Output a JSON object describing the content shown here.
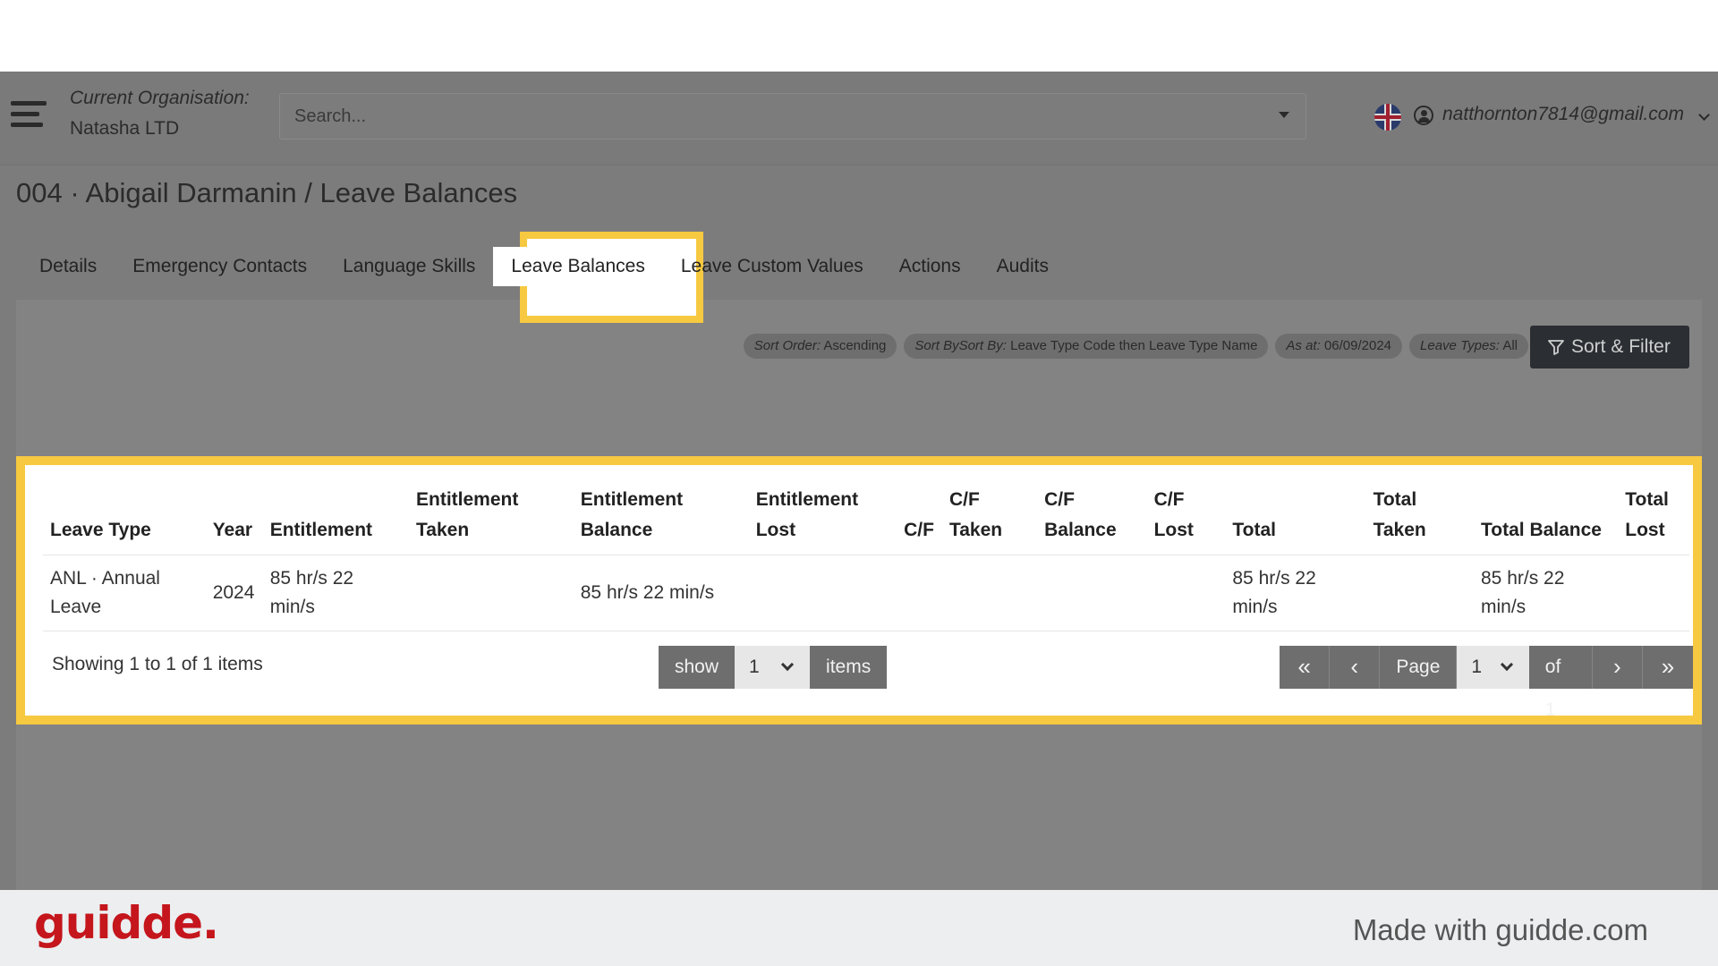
{
  "header": {
    "org_label": "Current Organisation:",
    "org_name": "Natasha LTD",
    "search_placeholder": "Search...",
    "email": "natthornton7814@gmail.com"
  },
  "page": {
    "title_prefix": "004 · Abigail Darmanin / ",
    "title_current": "Leave Balances"
  },
  "tabs": [
    {
      "label": "Details"
    },
    {
      "label": "Emergency Contacts"
    },
    {
      "label": "Language Skills"
    },
    {
      "label": "Leave Balances",
      "active": true
    },
    {
      "label": "Leave Custom Values"
    },
    {
      "label": "Actions"
    },
    {
      "label": "Audits"
    }
  ],
  "filters": {
    "sort_order_label": "Sort Order:",
    "sort_order_value": "Ascending",
    "sort_by_label": "Sort BySort By:",
    "sort_by_value": "Leave Type Code then Leave Type Name",
    "as_at_label": "As at:",
    "as_at_value": "06/09/2024",
    "leave_types_label": "Leave Types:",
    "leave_types_value": "All",
    "sort_filter_button": "Sort & Filter"
  },
  "table": {
    "columns": [
      {
        "line1": "",
        "line2": "Leave Type"
      },
      {
        "line1": "",
        "line2": "Year"
      },
      {
        "line1": "",
        "line2": "Entitlement"
      },
      {
        "line1": "Entitlement",
        "line2": "Taken"
      },
      {
        "line1": "Entitlement",
        "line2": "Balance"
      },
      {
        "line1": "Entitlement",
        "line2": "Lost"
      },
      {
        "line1": "",
        "line2": "C/F"
      },
      {
        "line1": "C/F",
        "line2": "Taken"
      },
      {
        "line1": "C/F",
        "line2": "Balance"
      },
      {
        "line1": "C/F",
        "line2": "Lost"
      },
      {
        "line1": "",
        "line2": "Total"
      },
      {
        "line1": "Total",
        "line2": "Taken"
      },
      {
        "line1": "",
        "line2": "Total Balance"
      },
      {
        "line1": "Total",
        "line2": "Lost"
      }
    ],
    "rows": [
      [
        "ANL · Annual Leave",
        "2024",
        "85 hr/s 22 min/s",
        "",
        "85 hr/s 22 min/s",
        "",
        "",
        "",
        "",
        "",
        "85 hr/s 22 min/s",
        "",
        "85 hr/s 22 min/s",
        ""
      ]
    ]
  },
  "pagination": {
    "showing": "Showing 1 to 1 of 1 items",
    "show_label": "show",
    "page_size": "1",
    "items_label": "items",
    "page_label": "Page",
    "current_page": "1",
    "of_label": "of 1"
  },
  "footer": {
    "logo": "guidde.",
    "made_with": "Made with guidde.com"
  },
  "colors": {
    "highlight": "#f7c940",
    "brand": "#c4161c",
    "overlay": "#7c7c7c"
  }
}
